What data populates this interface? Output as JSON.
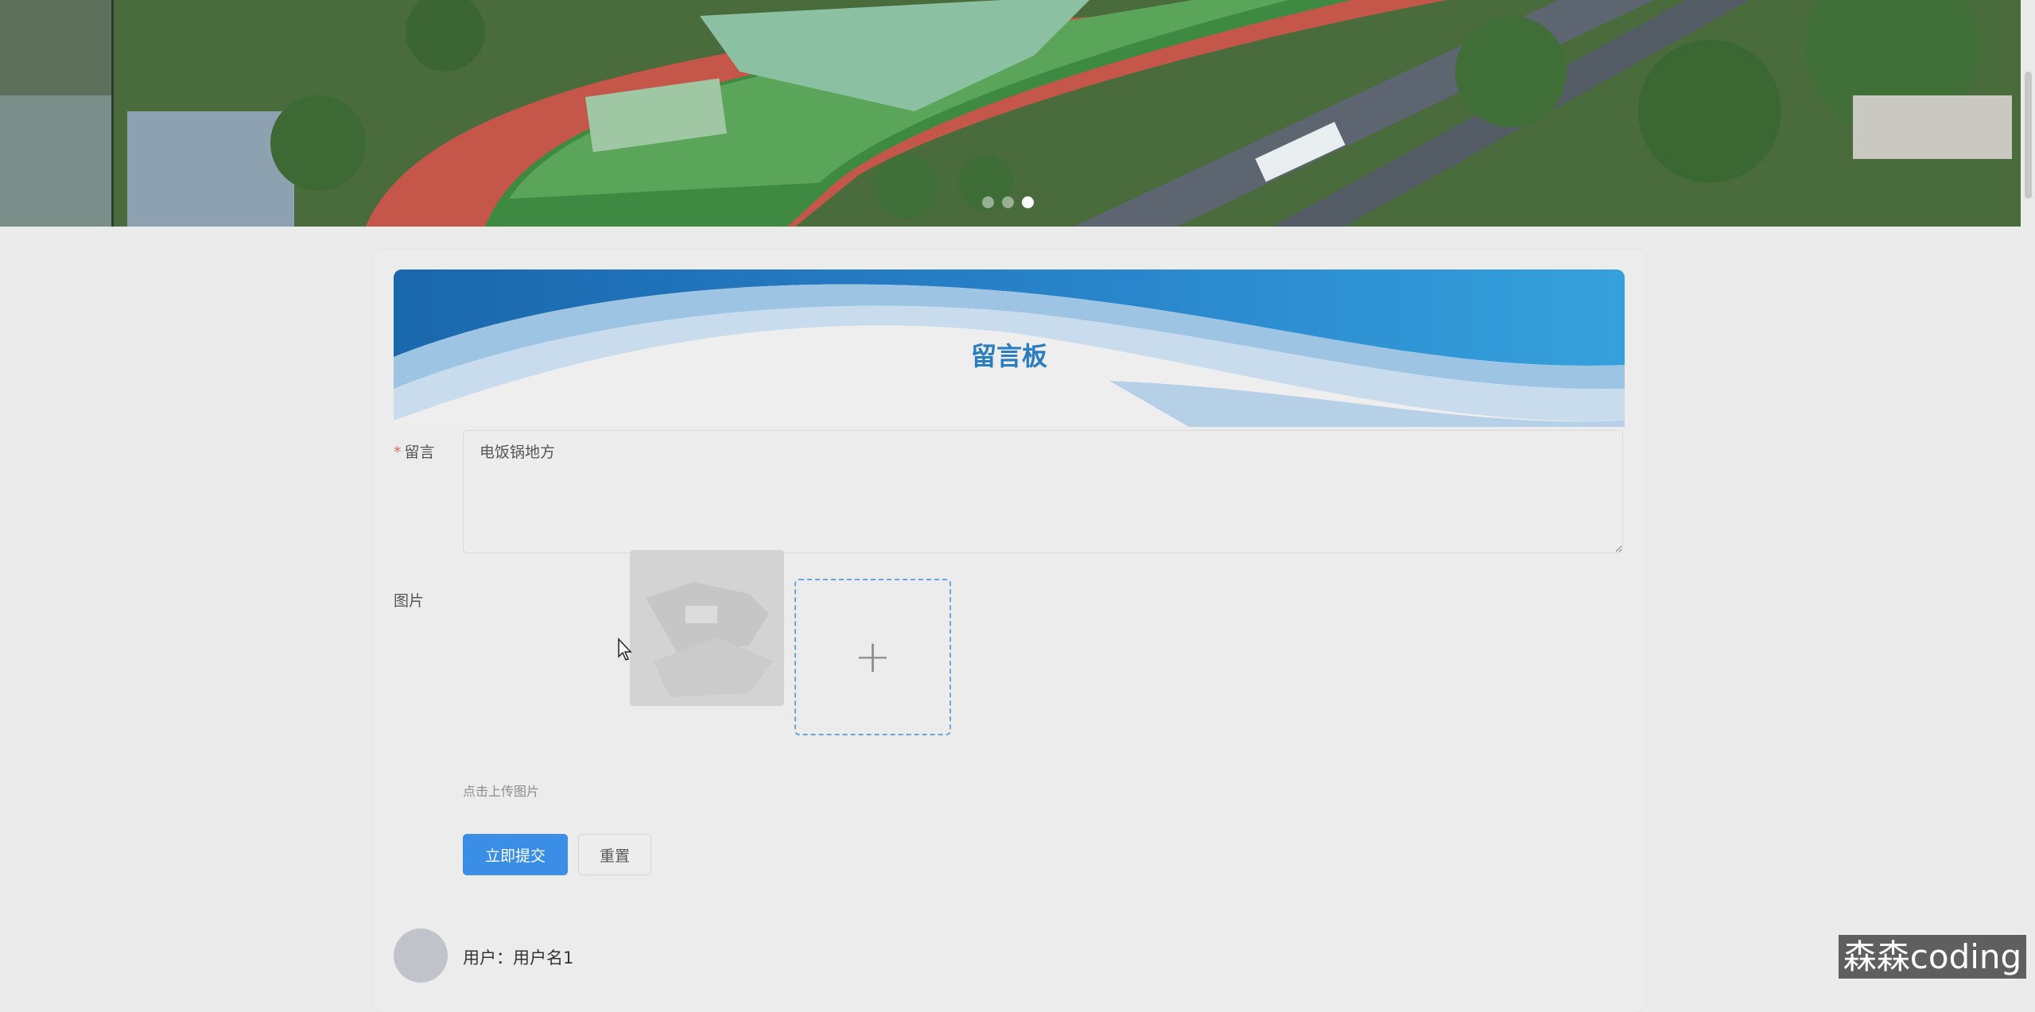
{
  "banner": {
    "slides": 3,
    "active_index": 2
  },
  "board": {
    "title": "留言板"
  },
  "form": {
    "message_label": "留言",
    "message_required_mark": "*",
    "message_value": "电饭锅地方",
    "image_label": "图片",
    "upload_hint": "点击上传图片",
    "upload_plus": "+",
    "submit_label": "立即提交",
    "reset_label": "重置"
  },
  "comments": [
    {
      "user_text": "用户：用户名1"
    }
  ],
  "watermark": "森森coding",
  "colors": {
    "primary": "#3a8ee6",
    "title": "#2a7ec0",
    "header_wave": "#1f72b8"
  }
}
